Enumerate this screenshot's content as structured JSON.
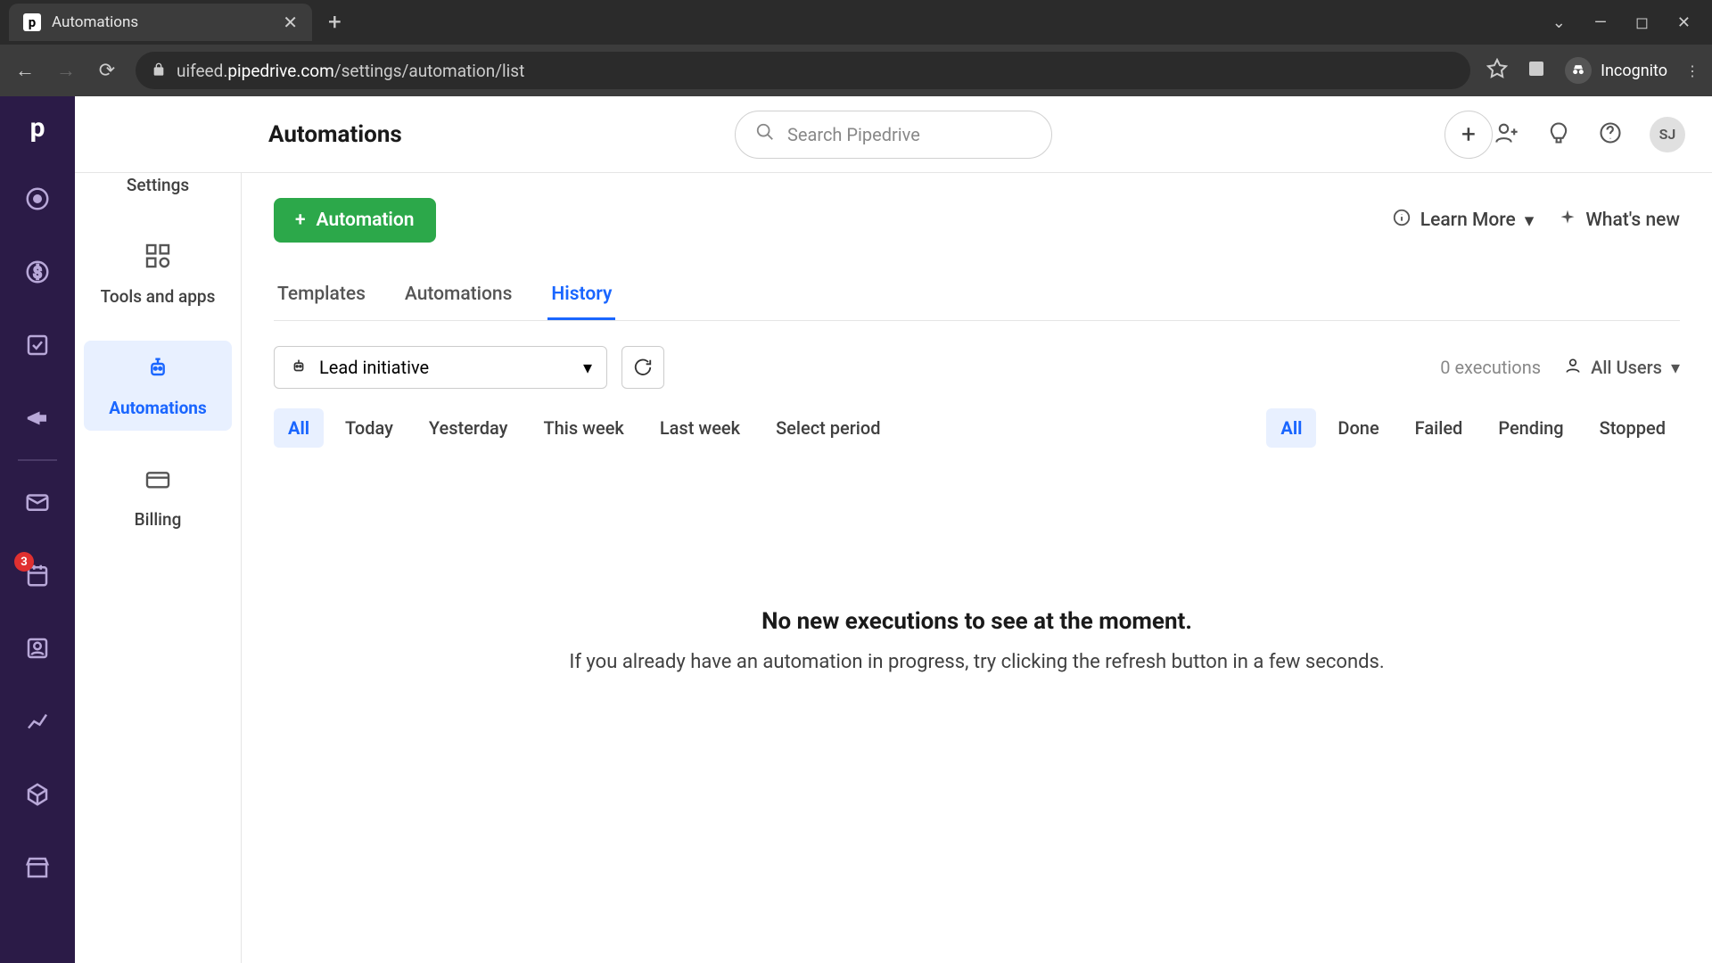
{
  "browser": {
    "tab_title": "Automations",
    "url_prefix": "uifeed.",
    "url_domain": "pipedrive.com",
    "url_path": "/settings/automation/list",
    "incognito_label": "Incognito"
  },
  "rail": {
    "badge_count": "3"
  },
  "sidebar": {
    "items": [
      {
        "label": "Settings"
      },
      {
        "label": "Tools and apps"
      },
      {
        "label": "Automations"
      },
      {
        "label": "Billing"
      }
    ]
  },
  "topbar": {
    "title": "Automations",
    "search_placeholder": "Search Pipedrive",
    "avatar_initials": "SJ"
  },
  "content": {
    "new_btn": "Automation",
    "learn_more": "Learn More",
    "whats_new": "What's new",
    "tabs": [
      "Templates",
      "Automations",
      "History"
    ],
    "active_tab": 2,
    "dropdown_value": "Lead initiative",
    "exec_count": "0 executions",
    "user_filter": "All Users",
    "time_chips": [
      "All",
      "Today",
      "Yesterday",
      "This week",
      "Last week",
      "Select period"
    ],
    "active_time_chip": 0,
    "status_chips": [
      "All",
      "Done",
      "Failed",
      "Pending",
      "Stopped"
    ],
    "active_status_chip": 0,
    "empty_title": "No new executions to see at the moment.",
    "empty_sub": "If you already have an automation in progress, try clicking the refresh button in a few seconds."
  }
}
